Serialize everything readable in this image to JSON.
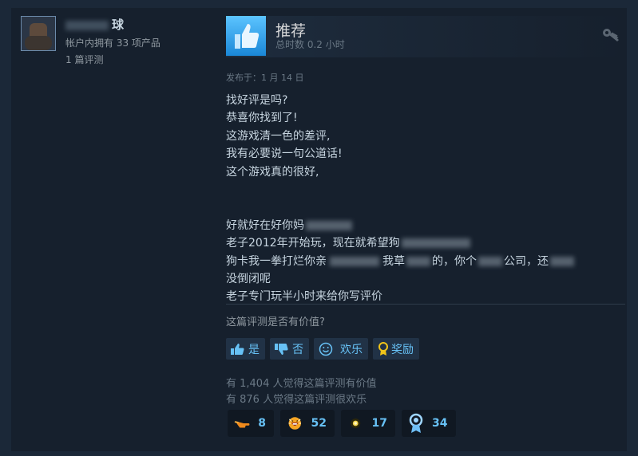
{
  "author": {
    "name_visible": "球",
    "owned": "帐户内拥有 33 项产品",
    "reviews": "1 篇评测"
  },
  "header": {
    "title": "推荐",
    "hours": "总时数 0.2 小时"
  },
  "posted": "发布于：1 月 14 日",
  "review": {
    "lines": [
      "找好评是吗?",
      "恭喜你找到了!",
      "这游戏清一色的差评,",
      "我有必要说一句公道话!",
      "这个游戏真的很好,",
      "",
      "",
      "好就好在好你妈",
      "老子2012年开始玩，现在就希望狗",
      "狗卡我一拳打烂你亲",
      "没倒闭呢",
      "老子专门玩半小时来给你写评价"
    ],
    "line9_a": "狗卡我一拳打烂你亲",
    "line9_b": "我草",
    "line9_c": "的，你个",
    "line9_d": "公司，还",
    "line8_a": "老子2012年开始玩，现在就希望狗"
  },
  "helpful_question": "这篇评测是否有价值?",
  "votes": {
    "yes": "是",
    "no": "否",
    "funny": "欢乐",
    "award": "奖励"
  },
  "stats": {
    "helpful": "有 1,404 人觉得这篇评测有价值",
    "funny": "有 876 人觉得这篇评测很欢乐"
  },
  "awards": [
    {
      "icon": "hand-point-icon",
      "count": "8"
    },
    {
      "icon": "laughing-face-icon",
      "count": "52"
    },
    {
      "icon": "sparkle-dot-icon",
      "count": "17"
    },
    {
      "icon": "ribbon-medal-icon",
      "count": "34"
    }
  ],
  "colors": {
    "background": "#1b2838",
    "accent": "#67c1f5",
    "thumb": "#1a9fff"
  }
}
